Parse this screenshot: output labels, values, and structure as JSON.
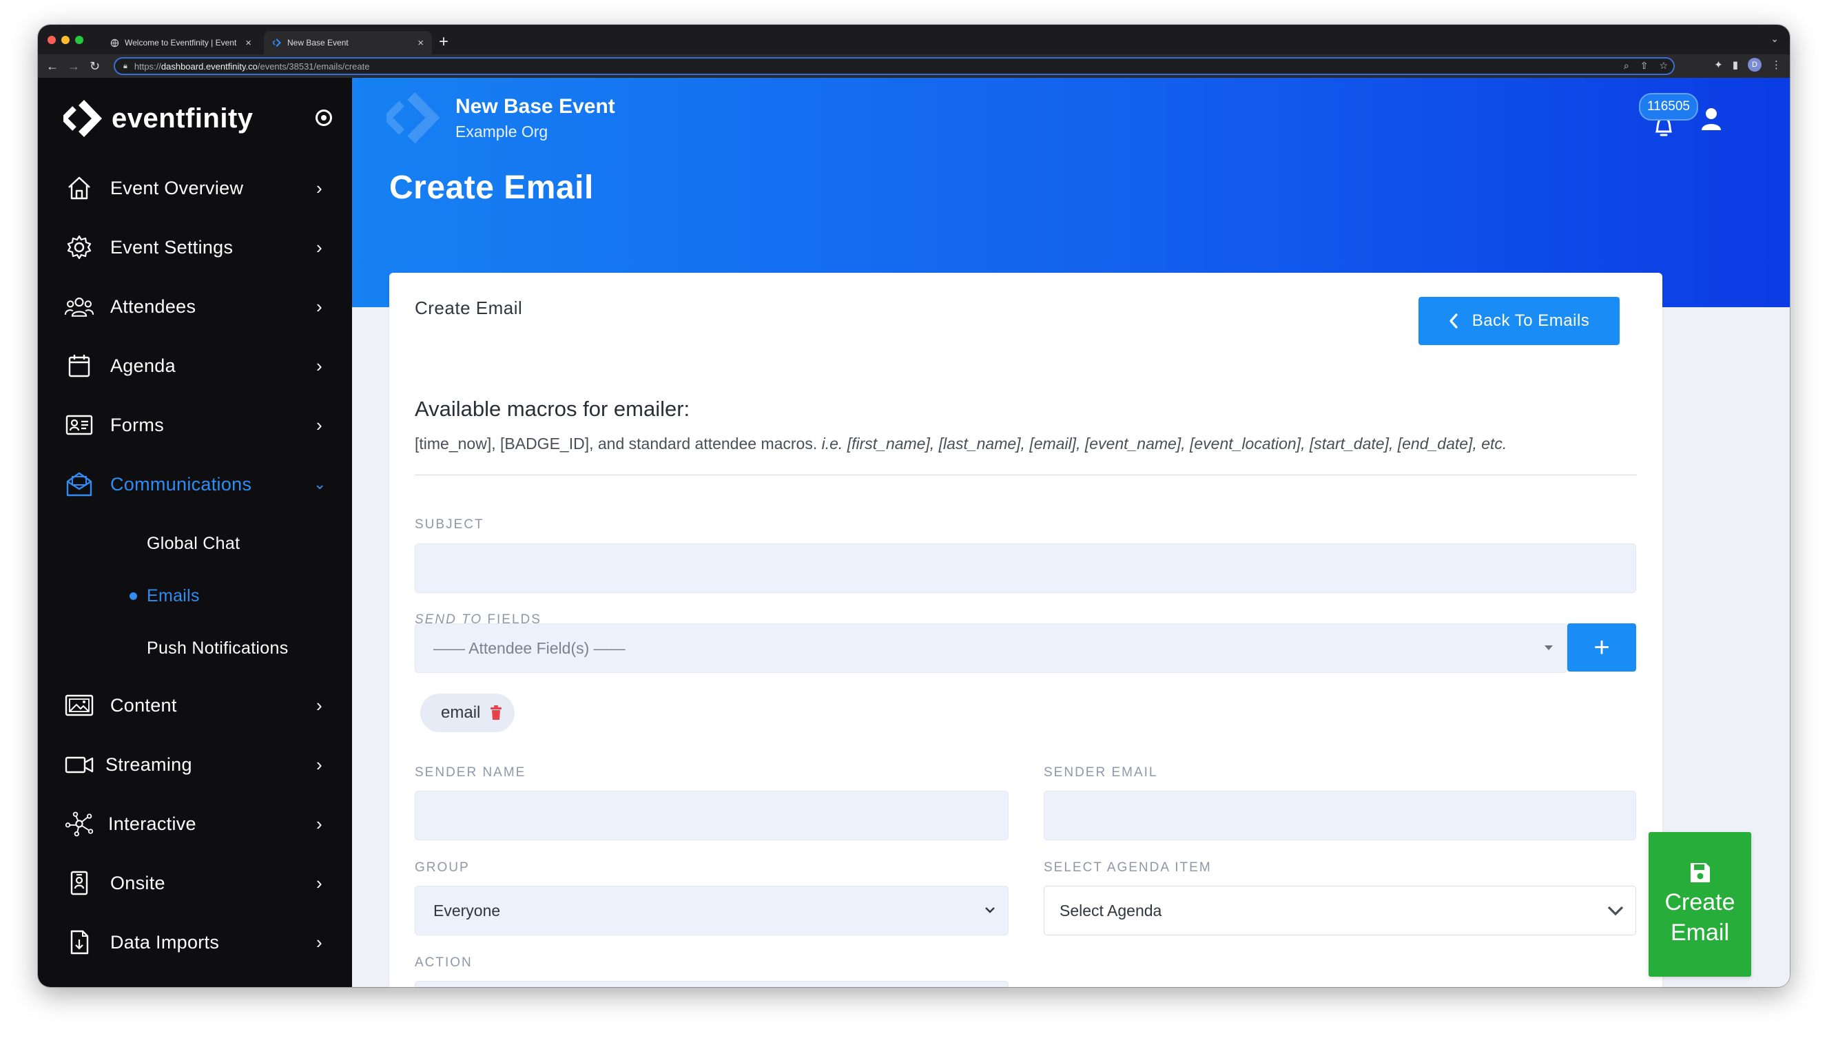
{
  "browser": {
    "tabs": [
      {
        "title": "Welcome to Eventfinity | Event",
        "active": false
      },
      {
        "title": "New Base Event",
        "active": true
      }
    ],
    "url_scheme": "https://",
    "url_host": "dashboard.eventfinity.co",
    "url_path": "/events/38531/emails/create",
    "profile_initial": "D"
  },
  "sidebar": {
    "brand": "eventfinity",
    "items": [
      {
        "label": "Event Overview",
        "icon": "home-icon",
        "active": false,
        "expanded": false
      },
      {
        "label": "Event Settings",
        "icon": "gear-icon",
        "active": false,
        "expanded": false
      },
      {
        "label": "Attendees",
        "icon": "people-icon",
        "active": false,
        "expanded": false
      },
      {
        "label": "Agenda",
        "icon": "calendar-icon",
        "active": false,
        "expanded": false
      },
      {
        "label": "Forms",
        "icon": "id-card-icon",
        "active": false,
        "expanded": false
      },
      {
        "label": "Communications",
        "icon": "envelope-open-icon",
        "active": true,
        "expanded": true
      },
      {
        "label": "Content",
        "icon": "images-icon",
        "active": false,
        "expanded": false
      },
      {
        "label": "Streaming",
        "icon": "video-camera-icon",
        "active": false,
        "expanded": false
      },
      {
        "label": "Interactive",
        "icon": "network-icon",
        "active": false,
        "expanded": false
      },
      {
        "label": "Onsite",
        "icon": "badge-icon",
        "active": false,
        "expanded": false
      },
      {
        "label": "Data Imports",
        "icon": "file-import-icon",
        "active": false,
        "expanded": false
      }
    ],
    "sub_items": [
      {
        "label": "Global Chat",
        "active": false
      },
      {
        "label": "Emails",
        "active": true
      },
      {
        "label": "Push Notifications",
        "active": false
      }
    ]
  },
  "header": {
    "event_name": "New Base Event",
    "org_name": "Example Org",
    "notification_count": "116505"
  },
  "page": {
    "title": "Create Email"
  },
  "card": {
    "title": "Create Email",
    "back_button": "Back To Emails",
    "macros_title": "Available macros for emailer:",
    "macros_plain": "[time_now], [BADGE_ID], and standard attendee macros. ",
    "macros_italic": "i.e. [first_name], [last_name], [email], [event_name], [event_location], [start_date], [end_date], etc.",
    "subject": {
      "label": "SUBJECT",
      "value": ""
    },
    "send_to": {
      "label_italic": "SEND TO",
      "label_rest": " FIELDS",
      "placeholder": "—— Attendee Field(s) ——",
      "add_button": "+",
      "chips": [
        "email"
      ]
    },
    "sender_name": {
      "label": "SENDER NAME",
      "value": ""
    },
    "sender_email": {
      "label": "SENDER EMAIL",
      "value": ""
    },
    "group": {
      "label": "GROUP",
      "selected": "Everyone"
    },
    "agenda": {
      "label": "SELECT AGENDA ITEM",
      "selected": "Select Agenda"
    },
    "action": {
      "label": "ACTION",
      "selected": ""
    }
  },
  "actions": {
    "create_line1": "Create",
    "create_line2": "Email"
  },
  "colors": {
    "accent": "#1a8cf5",
    "sidebar_bg": "#0e0e10",
    "active_nav": "#2e8cf4",
    "create_button": "#27ae3a",
    "delete_icon": "#e8414b"
  }
}
